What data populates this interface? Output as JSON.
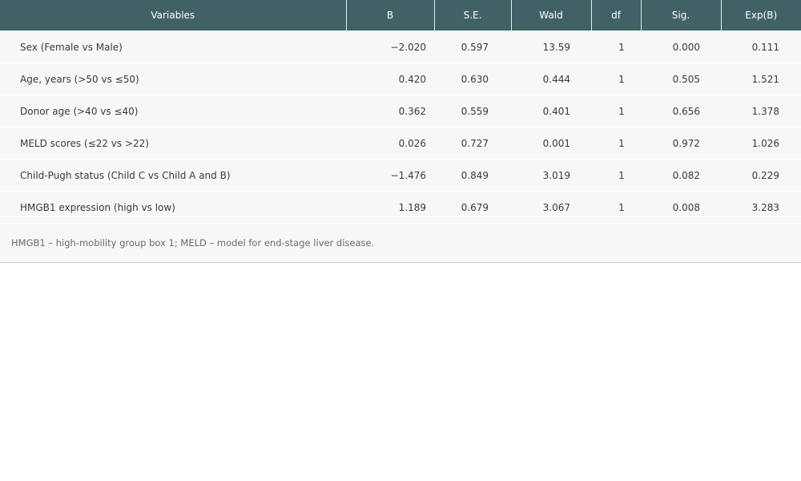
{
  "table": {
    "columns": [
      "Variables",
      "B",
      "S.E.",
      "Wald",
      "df",
      "Sig.",
      "Exp(B)"
    ],
    "rows": [
      [
        "Sex (Female vs Male)",
        "−2.020",
        "0.597",
        "13.59",
        "1",
        "0.000",
        "0.111"
      ],
      [
        "Age, years (>50 vs ≤50)",
        "0.420",
        "0.630",
        "0.444",
        "1",
        "0.505",
        "1.521"
      ],
      [
        "Donor age (>40 vs ≤40)",
        "0.362",
        "0.559",
        "0.401",
        "1",
        "0.656",
        "1.378"
      ],
      [
        "MELD scores (≤22 vs >22)",
        "0.026",
        "0.727",
        "0.001",
        "1",
        "0.972",
        "1.026"
      ],
      [
        "Child-Pugh status (Child C vs Child A and B)",
        "−1.476",
        "0.849",
        "3.019",
        "1",
        "0.082",
        "0.229"
      ],
      [
        "HMGB1 expression (high vs low)",
        "1.189",
        "0.679",
        "3.067",
        "1",
        "0.008",
        "3.283"
      ]
    ],
    "footnote": "HMGB1 – high-mobility group box 1; MELD – model for end-stage liver disease."
  },
  "colors": {
    "header_bg": "#416167",
    "row_bg": "#f7f7f7"
  }
}
